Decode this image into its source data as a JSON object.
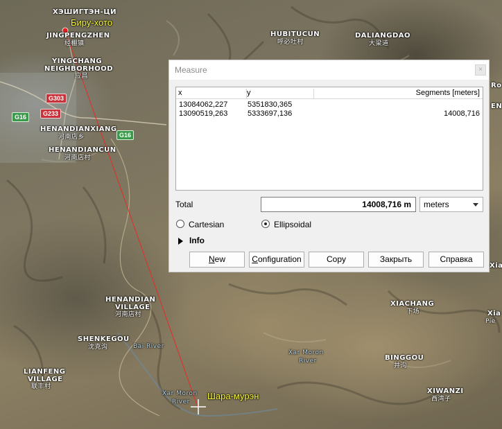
{
  "map": {
    "markers": [
      {
        "label": "Биру-хото"
      },
      {
        "label": "Шара-мурэн"
      }
    ],
    "place_labels": [
      {
        "text": "ХЭШИГТЭН-ЦИ"
      },
      {
        "text": "JINGPENGZHEN"
      },
      {
        "text": "经棚镇"
      },
      {
        "text": "YINGCHANG"
      },
      {
        "text": "NEIGHBORHOOD"
      },
      {
        "text": "应昌"
      },
      {
        "text": "HUBITUCUN"
      },
      {
        "text": "呼必吐村"
      },
      {
        "text": "DALIANGDAO"
      },
      {
        "text": "大梁道"
      },
      {
        "text": "HENANDIANXIANG"
      },
      {
        "text": "河南店乡"
      },
      {
        "text": "HENANDIANCUN"
      },
      {
        "text": "河南店村"
      },
      {
        "text": "HENANDIAN"
      },
      {
        "text": "VILLAGE"
      },
      {
        "text": "河南店村"
      },
      {
        "text": "SHENKEGOU"
      },
      {
        "text": "沈克沟"
      },
      {
        "text": "LIANFENG"
      },
      {
        "text": "VILLAGE"
      },
      {
        "text": "联丰村"
      },
      {
        "text": "XIACHANG"
      },
      {
        "text": "下场"
      },
      {
        "text": "BINGGOU"
      },
      {
        "text": "并沟"
      },
      {
        "text": "XIWANZI"
      },
      {
        "text": "西湾子"
      }
    ],
    "river_labels": [
      {
        "text": "Bai River"
      },
      {
        "text": "Xar Moron"
      },
      {
        "text": "River"
      },
      {
        "text": "Xar Moron"
      },
      {
        "text": "River"
      }
    ],
    "road_shields": [
      {
        "text": "G303",
        "color": "#c8323a"
      },
      {
        "text": "G16",
        "color": "#3a9a4a"
      },
      {
        "text": "G233",
        "color": "#c8323a"
      },
      {
        "text": "G16",
        "color": "#3a9a4a"
      }
    ],
    "edge_labels": [
      {
        "text": "Ro"
      },
      {
        "text": "EN"
      },
      {
        "text": "Xiao"
      },
      {
        "text": "Xia"
      },
      {
        "text": "Pie"
      }
    ],
    "measure_line_color": "#e0302a"
  },
  "dialog": {
    "title": "Measure",
    "close_symbol": "×",
    "columns": {
      "x": "x",
      "y": "y",
      "segments": "Segments [meters]"
    },
    "rows": [
      {
        "x": "13084062,227",
        "y": "5351830,365",
        "segment": ""
      },
      {
        "x": "13090519,263",
        "y": "5333697,136",
        "segment": "14008,716"
      }
    ],
    "total_label": "Total",
    "total_value": "14008,716 m",
    "unit": "meters",
    "radio_cartesian": "Cartesian",
    "radio_ellipsoidal": "Ellipsoidal",
    "selected_mode": "Ellipsoidal",
    "info_label": "Info",
    "buttons": {
      "new_u": "N",
      "new_rest": "ew",
      "config_u": "C",
      "config_rest": "onfiguration",
      "copy": "Copy",
      "close": "Закрыть",
      "help": "Справка"
    }
  }
}
